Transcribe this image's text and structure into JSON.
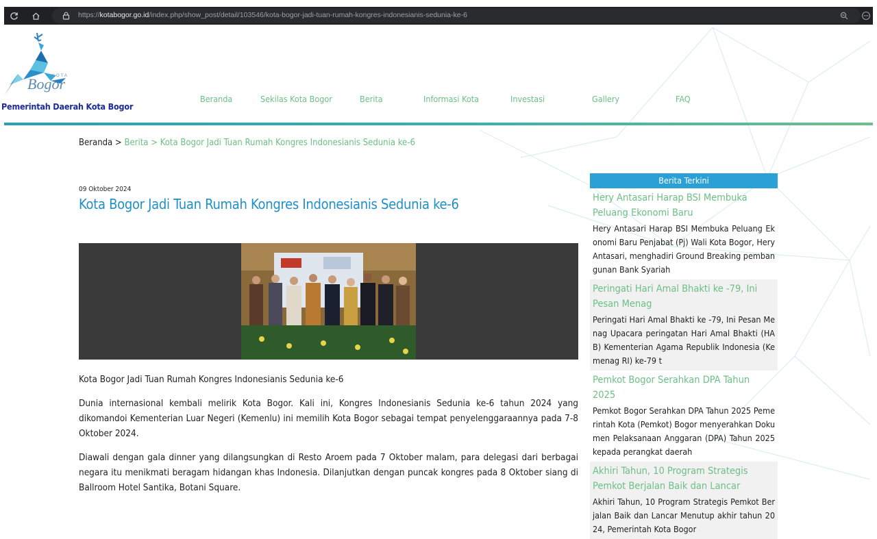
{
  "browser": {
    "url_prefix": "https://",
    "url_domain": "kotabogor.go.id",
    "url_path": "/index.php/show_post/detail/103546/kota-bogor-jadi-tuan-rumah-kongres-indonesianis-sedunia-ke-6"
  },
  "header": {
    "logo_small": "KOTA",
    "logo_script": "Bogor",
    "gov_name": "Pemerintah Daerah Kota Bogor",
    "nav": [
      "Beranda",
      "Sekilas Kota Bogor",
      "Berita",
      "Informasi Kota",
      "Investasi",
      "Gallery",
      "FAQ"
    ]
  },
  "breadcrumb": {
    "home": "Beranda",
    "sep": " > ",
    "section": "Berita",
    "current": "Kota Bogor Jadi Tuan Rumah Kongres Indonesianis Sedunia ke-6"
  },
  "article": {
    "date": "09 Oktober 2024",
    "title": "Kota Bogor Jadi Tuan Rumah Kongres Indonesianis Sedunia ke-6",
    "paragraphs": [
      "Kota Bogor Jadi Tuan Rumah Kongres Indonesianis Sedunia ke-6",
      "Dunia internasional kembali melirik Kota Bogor. Kali ini, Kongres Indonesianis Sedunia ke-6 tahun 2024 yang dikomandoi Kementerian Luar Negeri (Kemenlu) ini memilih Kota Bogor sebagai tempat penyelenggaraannya pada 7-8 Oktober 2024.",
      "Diawali dengan gala dinner yang dilangsungkan di Resto Aroem pada 7 Oktober malam, para delegasi dari berbagai negara itu menikmati beragam hidangan khas Indonesia. Dilanjutkan dengan puncak kongres pada 8 Oktober siang di Ballroom Hotel Santika, Botani Square."
    ]
  },
  "sidebar": {
    "heading": "Berita Terkini",
    "items": [
      {
        "title": "Hery Antasari Harap BSI Membuka Peluang Ekonomi Baru",
        "excerpt": "Hery Antasari Harap BSI Membuka Peluang Ekonomi Baru Penjabat (Pj) Wali Kota Bogor, Hery Antasari, menghadiri Ground Breaking pembangunan Bank Syariah"
      },
      {
        "title": "Peringati Hari Amal Bhakti ke -79, Ini Pesan Menag",
        "excerpt": "Peringati Hari Amal Bhakti ke -79, Ini Pesan Menag Upacara peringatan Hari Amal Bhakti (HAB) Kementerian Agama Republik Indonesia (Kemenag RI) ke-79 t"
      },
      {
        "title": "Pemkot Bogor Serahkan DPA Tahun 2025",
        "excerpt": "Pemkot Bogor Serahkan DPA Tahun 2025 Pemerintah Kota (Pemkot) Bogor menyerahkan Dokumen Pelaksanaan Anggaran (DPA) Tahun 2025 kepada perangkat daerah"
      },
      {
        "title": "Akhiri Tahun, 10 Program Strategis Pemkot Berjalan Baik dan Lancar",
        "excerpt": "Akhiri Tahun, 10 Program Strategis Pemkot Berjalan Baik dan Lancar Menutup akhir tahun 2024, Pemerintah Kota Bogor"
      }
    ]
  }
}
